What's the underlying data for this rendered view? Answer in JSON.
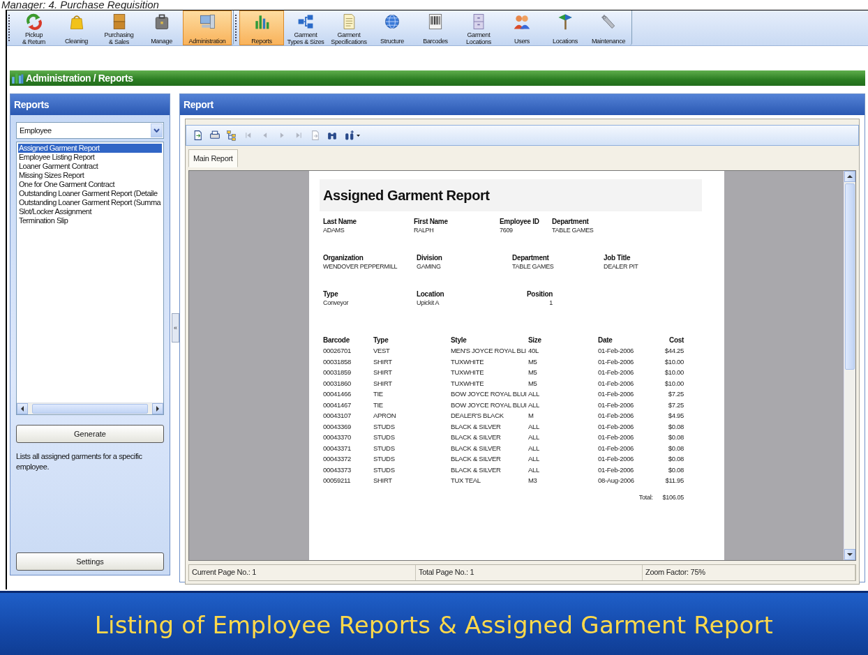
{
  "caption": "Manager: 4. Purchase Requisition",
  "toolbar": {
    "groups": [
      {
        "items": [
          {
            "label": "Pickup\n& Return",
            "selected": false
          },
          {
            "label": "Cleaning",
            "selected": false
          },
          {
            "label": "Purchasing\n& Sales",
            "selected": false
          },
          {
            "label": "Manage",
            "selected": false
          },
          {
            "label": "Administration",
            "selected": true
          }
        ]
      },
      {
        "items": [
          {
            "label": "Reports",
            "selected": true
          },
          {
            "label": "Garment\nTypes & Sizes",
            "selected": false
          },
          {
            "label": "Garment\nSpecifications",
            "selected": false
          },
          {
            "label": "Structure",
            "selected": false
          },
          {
            "label": "Barcodes",
            "selected": false
          },
          {
            "label": "Garment\nLocations",
            "selected": false
          },
          {
            "label": "Users",
            "selected": false
          },
          {
            "label": "Locations",
            "selected": false
          },
          {
            "label": "Maintenance",
            "selected": false
          }
        ]
      }
    ]
  },
  "breadcrumb": "Administration / Reports",
  "reports_panel": {
    "title": "Reports",
    "category": "Employee",
    "items": [
      {
        "label": "Assigned Garment Report",
        "selected": true
      },
      {
        "label": "Employee Listing Report",
        "selected": false
      },
      {
        "label": "Loaner Garment Contract",
        "selected": false
      },
      {
        "label": "Missing Sizes Report",
        "selected": false
      },
      {
        "label": "One for One Garment Contract",
        "selected": false
      },
      {
        "label": "Outstanding Loaner Garment Report (Detaile",
        "selected": false
      },
      {
        "label": "Outstanding Loaner Garment Report (Summa",
        "selected": false
      },
      {
        "label": "Slot/Locker Assignment",
        "selected": false
      },
      {
        "label": "Termination Slip",
        "selected": false
      }
    ],
    "generate_button": "Generate",
    "description": "Lists all assigned garments for a specific employee.",
    "settings_button": "Settings"
  },
  "collapse_handle": "«",
  "report_panel": {
    "title": "Report",
    "toolbar": [
      {
        "disabled": false
      },
      {
        "disabled": false
      },
      {
        "disabled": false
      },
      {
        "disabled": true
      },
      {
        "disabled": true
      },
      {
        "disabled": true
      },
      {
        "disabled": true
      },
      {
        "disabled": true
      },
      {
        "disabled": false
      },
      {
        "disabled": false
      }
    ],
    "tabs": [
      {
        "label": "Main Report",
        "selected": true
      }
    ],
    "document": {
      "title": "Assigned Garment Report",
      "field_rows": [
        [
          {
            "label": "Last Name",
            "value": "ADAMS"
          },
          {
            "label": "First Name",
            "value": "RALPH"
          },
          {
            "label": "Employee ID",
            "value": "7609"
          },
          {
            "label": "Department",
            "value": "TABLE GAMES"
          }
        ],
        [
          {
            "label": "Organization",
            "value": "WENDOVER PEPPERMILL"
          },
          {
            "label": "Division",
            "value": "GAMING"
          },
          {
            "label": "Department",
            "value": "TABLE GAMES"
          },
          {
            "label": "Job Title",
            "value": "DEALER PIT"
          }
        ],
        [
          {
            "label": "Type",
            "value": "Conveyor"
          },
          {
            "label": "Location",
            "value": "Upickit A"
          },
          {
            "label": "Position",
            "value": "1"
          }
        ]
      ],
      "table": {
        "columns": [
          "Barcode",
          "Type",
          "Style",
          "Size",
          "Date",
          "Cost"
        ],
        "rows": [
          [
            "00026701",
            "VEST",
            "MEN'S JOYCE ROYAL BLI",
            "40L",
            "01-Feb-2006",
            "$44.25"
          ],
          [
            "00031858",
            "SHIRT",
            "TUXWHITE",
            "M5",
            "01-Feb-2006",
            "$10.00"
          ],
          [
            "00031859",
            "SHIRT",
            "TUXWHITE",
            "M5",
            "01-Feb-2006",
            "$10.00"
          ],
          [
            "00031860",
            "SHIRT",
            "TUXWHITE",
            "M5",
            "01-Feb-2006",
            "$10.00"
          ],
          [
            "00041466",
            "TIE",
            "BOW JOYCE ROYAL BLUI",
            "ALL",
            "01-Feb-2006",
            "$7.25"
          ],
          [
            "00041467",
            "TIE",
            "BOW JOYCE ROYAL BLUI",
            "ALL",
            "01-Feb-2006",
            "$7.25"
          ],
          [
            "00043107",
            "APRON",
            "DEALER'S BLACK",
            "M",
            "01-Feb-2006",
            "$4.95"
          ],
          [
            "00043369",
            "STUDS",
            "BLACK & SILVER",
            "ALL",
            "01-Feb-2006",
            "$0.08"
          ],
          [
            "00043370",
            "STUDS",
            "BLACK & SILVER",
            "ALL",
            "01-Feb-2006",
            "$0.08"
          ],
          [
            "00043371",
            "STUDS",
            "BLACK & SILVER",
            "ALL",
            "01-Feb-2006",
            "$0.08"
          ],
          [
            "00043372",
            "STUDS",
            "BLACK & SILVER",
            "ALL",
            "01-Feb-2006",
            "$0.08"
          ],
          [
            "00043373",
            "STUDS",
            "BLACK & SILVER",
            "ALL",
            "01-Feb-2006",
            "$0.08"
          ],
          [
            "00059211",
            "SHIRT",
            "TUX TEAL",
            "M3",
            "08-Aug-2006",
            "$11.95"
          ]
        ]
      },
      "total_label": "Total:",
      "total_value": "$106.05"
    },
    "status_bar": [
      "Current Page No.: 1",
      "Total Page No.: 1",
      "Zoom Factor: 75%"
    ]
  },
  "banner": "Listing of Employee Reports & Assigned Garment Report"
}
